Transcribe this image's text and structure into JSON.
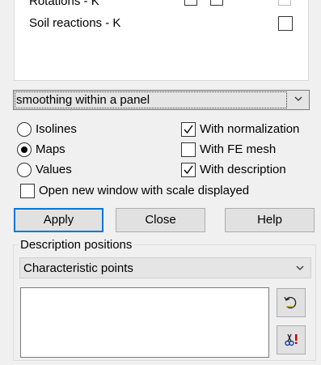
{
  "results_list": {
    "items": [
      {
        "label": "Rotations - K"
      },
      {
        "label": "Soil reactions - K"
      }
    ]
  },
  "smoothing_select": {
    "value": "smoothing within a panel"
  },
  "display_mode": {
    "options": [
      {
        "label": "Isolines",
        "selected": false
      },
      {
        "label": "Maps",
        "selected": true
      },
      {
        "label": "Values",
        "selected": false
      }
    ]
  },
  "options": {
    "with_normalization": {
      "label": "With normalization",
      "checked": true
    },
    "with_fe_mesh": {
      "label": "With FE mesh",
      "checked": false
    },
    "with_description": {
      "label": "With description",
      "checked": true
    },
    "open_new_window": {
      "label": "Open new window with scale displayed",
      "checked": false
    }
  },
  "buttons": {
    "apply": "Apply",
    "close": "Close",
    "help": "Help"
  },
  "description_positions": {
    "title": "Description positions",
    "select_value": "Characteristic points"
  },
  "icons": {
    "undo": "undo-icon",
    "delete": "scissors-delete-icon"
  }
}
